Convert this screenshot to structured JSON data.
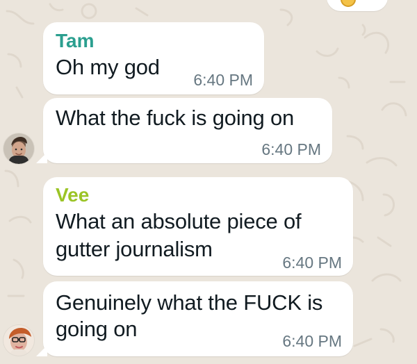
{
  "messages": [
    {
      "sender": "Tam",
      "sender_color": "#2b9f8f",
      "text_lines": [
        "Oh my god"
      ],
      "time": "6:40 PM"
    },
    {
      "sender": "",
      "text_lines": [
        "What the fuck is going on"
      ],
      "time": "6:40 PM"
    },
    {
      "sender": "Vee",
      "sender_color": "#9bc426",
      "text_lines": [
        "What an absolute piece of",
        "gutter journalism"
      ],
      "time": "6:40 PM"
    },
    {
      "sender": "",
      "text_lines": [
        "Genuinely what the FUCK is",
        "going on"
      ],
      "time": "6:40 PM"
    }
  ],
  "colors": {
    "background": "#ebe5dc",
    "bubble": "#ffffff",
    "text": "#111b21",
    "time": "#667781"
  },
  "icons": {
    "top_reaction": "emoji-reaction-icon",
    "avatar_1": "avatar-image",
    "avatar_2": "avatar-image"
  }
}
